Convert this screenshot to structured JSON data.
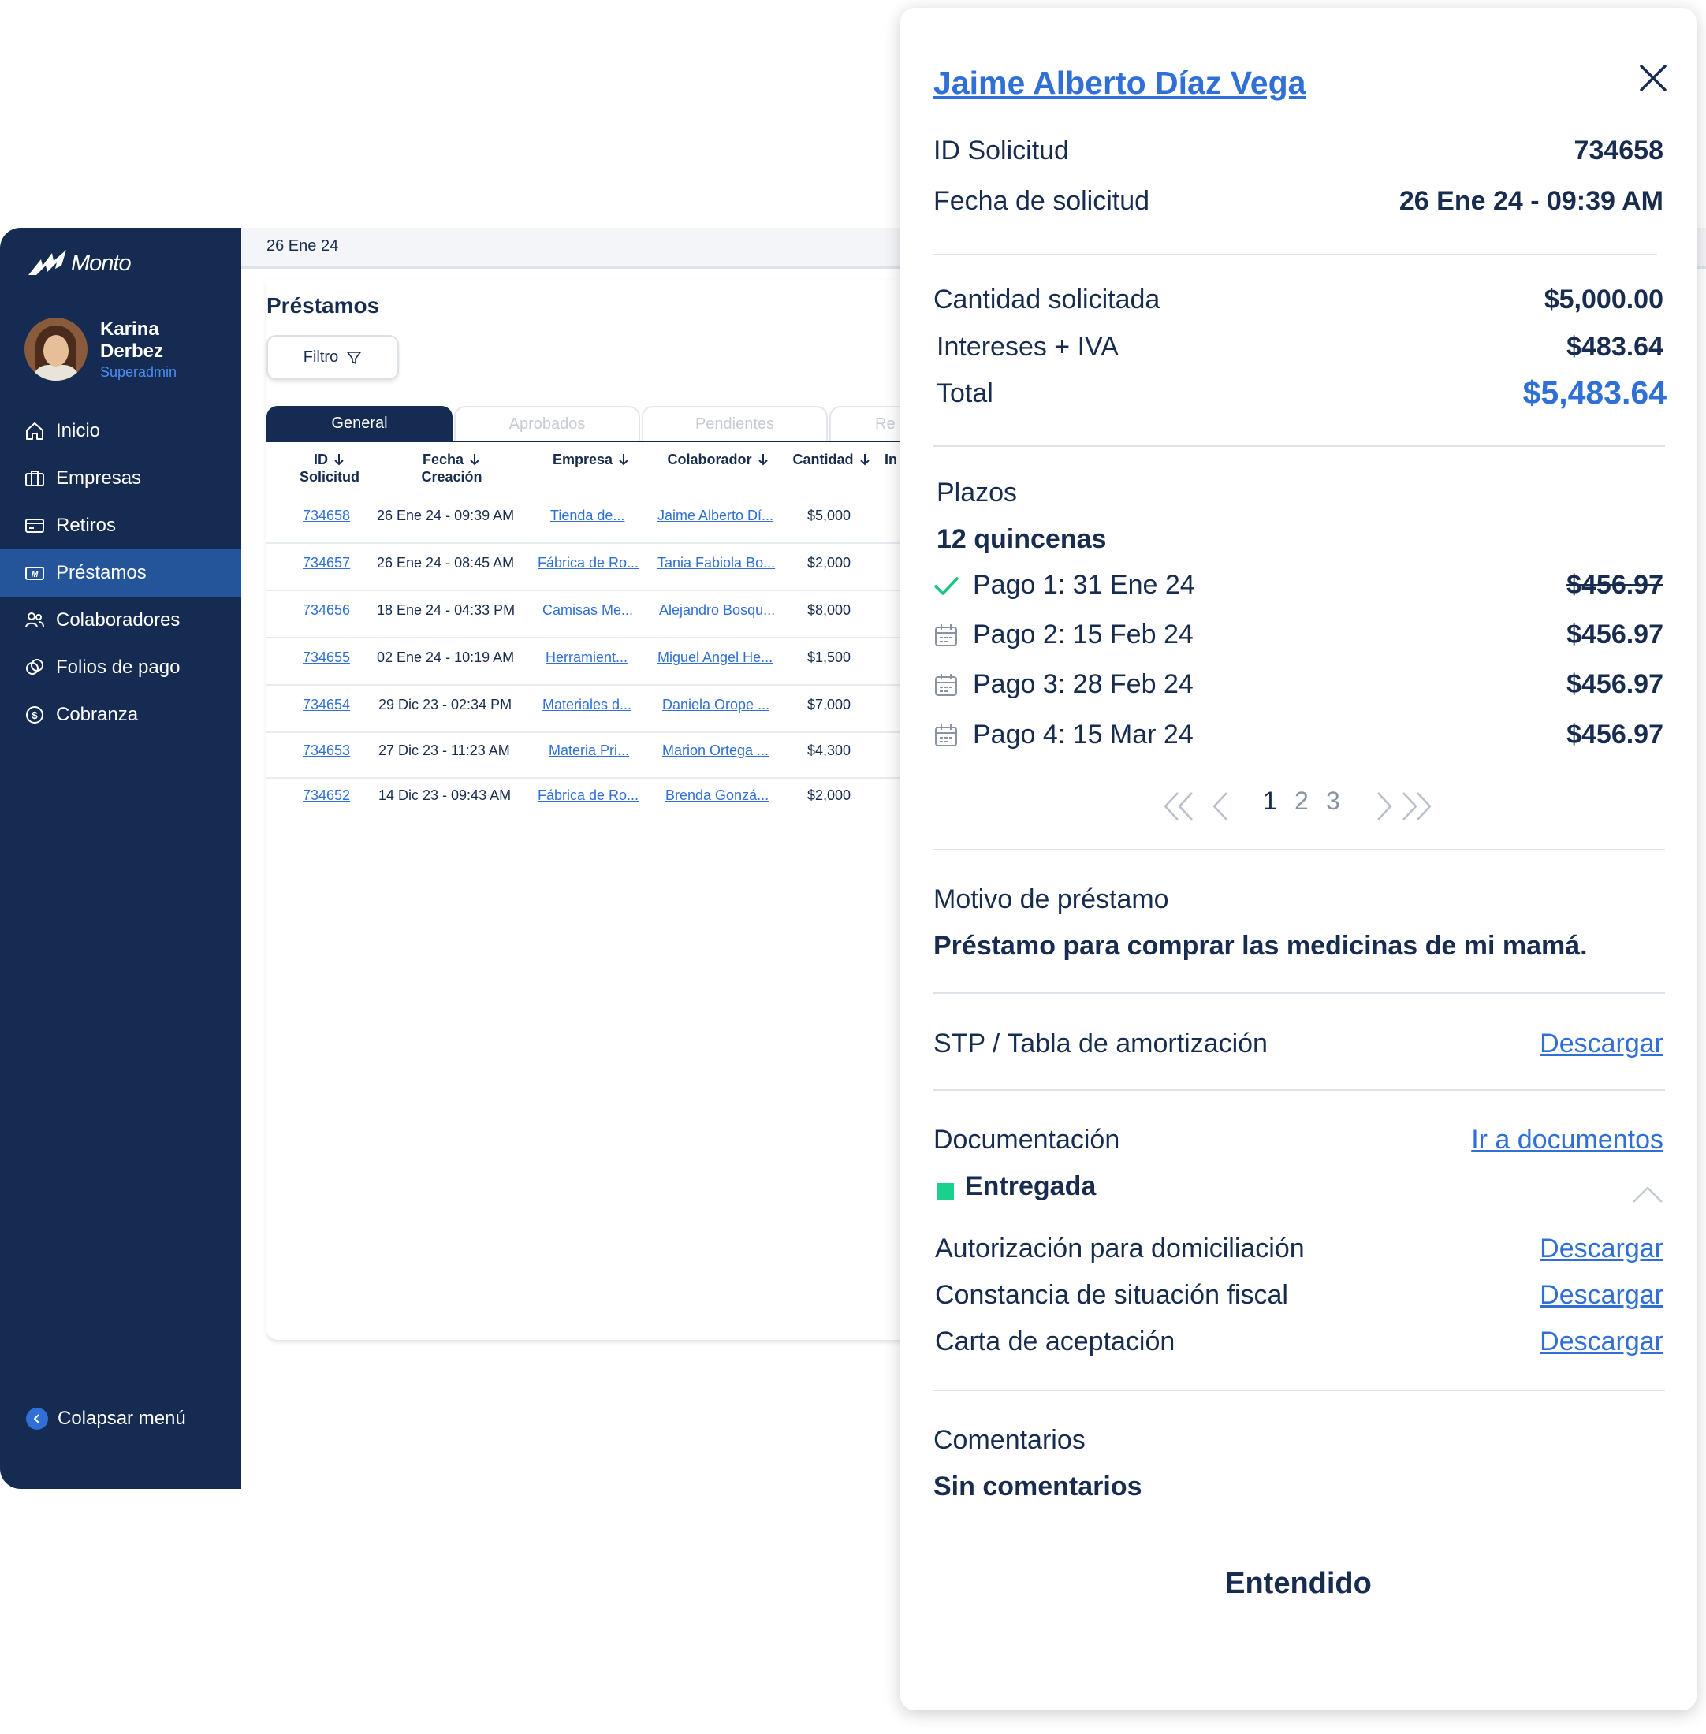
{
  "app": {
    "brand": "Monto"
  },
  "user": {
    "name": "Karina Derbez",
    "role": "Superadmin"
  },
  "nav": {
    "items": [
      {
        "label": "Inicio",
        "icon": "home-icon"
      },
      {
        "label": "Empresas",
        "icon": "briefcase-icon"
      },
      {
        "label": "Retiros",
        "icon": "card-icon"
      },
      {
        "label": "Préstamos",
        "icon": "loan-icon",
        "active": true
      },
      {
        "label": "Colaboradores",
        "icon": "users-icon"
      },
      {
        "label": "Folios de pago",
        "icon": "coins-icon"
      },
      {
        "label": "Cobranza",
        "icon": "dollar-circle-icon"
      }
    ],
    "collapse_label": "Colapsar menú"
  },
  "topbar": {
    "date": "26 Ene 24"
  },
  "loans": {
    "title": "Préstamos",
    "filter_label": "Filtro",
    "tabs": [
      "General",
      "Aprobados",
      "Pendientes",
      "Re"
    ],
    "columns": [
      "ID\nSolicitud",
      "Fecha\nCreación",
      "Empresa",
      "Colaborador",
      "Cantidad",
      "In"
    ],
    "rows": [
      {
        "id": "734658",
        "fecha": "26 Ene 24 - 09:39 AM",
        "empresa": "Tienda de...",
        "colaborador": "Jaime Alberto Dí...",
        "cantidad": "$5,000"
      },
      {
        "id": "734657",
        "fecha": "26 Ene 24 - 08:45 AM",
        "empresa": "Fábrica de Ro...",
        "colaborador": "Tania Fabiola Bo...",
        "cantidad": "$2,000"
      },
      {
        "id": "734656",
        "fecha": "18 Ene 24 - 04:33 PM",
        "empresa": "Camisas Me...",
        "colaborador": "Alejandro Bosqu...",
        "cantidad": "$8,000"
      },
      {
        "id": "734655",
        "fecha": "02 Ene 24 - 10:19 AM",
        "empresa": "Herramient...",
        "colaborador": "Miguel Angel He...",
        "cantidad": "$1,500"
      },
      {
        "id": "734654",
        "fecha": "29 Dic 23 - 02:34 PM",
        "empresa": "Materiales d...",
        "colaborador": "Daniela Orope ...",
        "cantidad": "$7,000"
      },
      {
        "id": "734653",
        "fecha": "27 Dic 23 - 11:23 AM",
        "empresa": "Materia Pri...",
        "colaborador": "Marion Ortega ...",
        "cantidad": "$4,300"
      },
      {
        "id": "734652",
        "fecha": "14 Dic 23 - 09:43 AM",
        "empresa": "Fábrica de Ro...",
        "colaborador": "Brenda Gonzá...",
        "cantidad": "$2,000"
      }
    ]
  },
  "detail": {
    "name": "Jaime Alberto Díaz Vega",
    "id_label": "ID Solicitud",
    "id_value": "734658",
    "fecha_label": "Fecha de solicitud",
    "fecha_value": "26 Ene 24 - 09:39 AM",
    "cantidad_label": "Cantidad solicitada",
    "cantidad_value": "$5,000.00",
    "intereses_label": "Intereses + IVA",
    "intereses_value": "$483.64",
    "total_label": "Total",
    "total_value": "$5,483.64",
    "plazos_label": "Plazos",
    "plazos_value": "12 quincenas",
    "pagos": [
      {
        "label": "Pago 1: 31 Ene 24",
        "amount": "$456.97",
        "paid": true
      },
      {
        "label": "Pago 2: 15 Feb 24",
        "amount": "$456.97",
        "paid": false
      },
      {
        "label": "Pago 3: 28 Feb 24",
        "amount": "$456.97",
        "paid": false
      },
      {
        "label": "Pago 4: 15 Mar 24",
        "amount": "$456.97",
        "paid": false
      }
    ],
    "pagination": {
      "pages": [
        "1",
        "2",
        "3"
      ],
      "current": "1"
    },
    "motivo_label": "Motivo de préstamo",
    "motivo_value": "Préstamo para comprar las medicinas de mi mamá.",
    "stp_label": "STP / Tabla de amortización",
    "download_label": "Descargar",
    "doc_label": "Documentación",
    "doc_link": "Ir a documentos",
    "doc_status": "Entregada",
    "doc_status_color": "#19d18c",
    "docs": [
      "Autorización para domiciliación",
      "Constancia de situación fiscal",
      "Carta de aceptación"
    ],
    "comentarios_label": "Comentarios",
    "comentarios_value": "Sin comentarios",
    "confirm_label": "Entendido"
  },
  "colors": {
    "navy": "#162b52",
    "accent": "#2f6fd6",
    "active_nav": "#24549a",
    "success": "#19d18c"
  }
}
